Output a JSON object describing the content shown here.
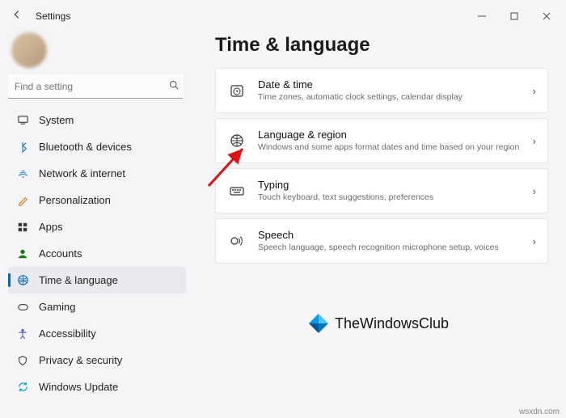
{
  "window": {
    "title": "Settings"
  },
  "search": {
    "placeholder": "Find a setting"
  },
  "sidebar": {
    "items": [
      {
        "label": "System"
      },
      {
        "label": "Bluetooth & devices"
      },
      {
        "label": "Network & internet"
      },
      {
        "label": "Personalization"
      },
      {
        "label": "Apps"
      },
      {
        "label": "Accounts"
      },
      {
        "label": "Time & language"
      },
      {
        "label": "Gaming"
      },
      {
        "label": "Accessibility"
      },
      {
        "label": "Privacy & security"
      },
      {
        "label": "Windows Update"
      }
    ],
    "selected_index": 6
  },
  "main": {
    "title": "Time & language",
    "cards": [
      {
        "title": "Date & time",
        "desc": "Time zones, automatic clock settings, calendar display"
      },
      {
        "title": "Language & region",
        "desc": "Windows and some apps format dates and time based on your region"
      },
      {
        "title": "Typing",
        "desc": "Touch keyboard, text suggestions, preferences"
      },
      {
        "title": "Speech",
        "desc": "Speech language, speech recognition microphone setup, voices"
      }
    ]
  },
  "watermark": {
    "text": "TheWindowsClub",
    "footer": "wsxdn.com"
  }
}
